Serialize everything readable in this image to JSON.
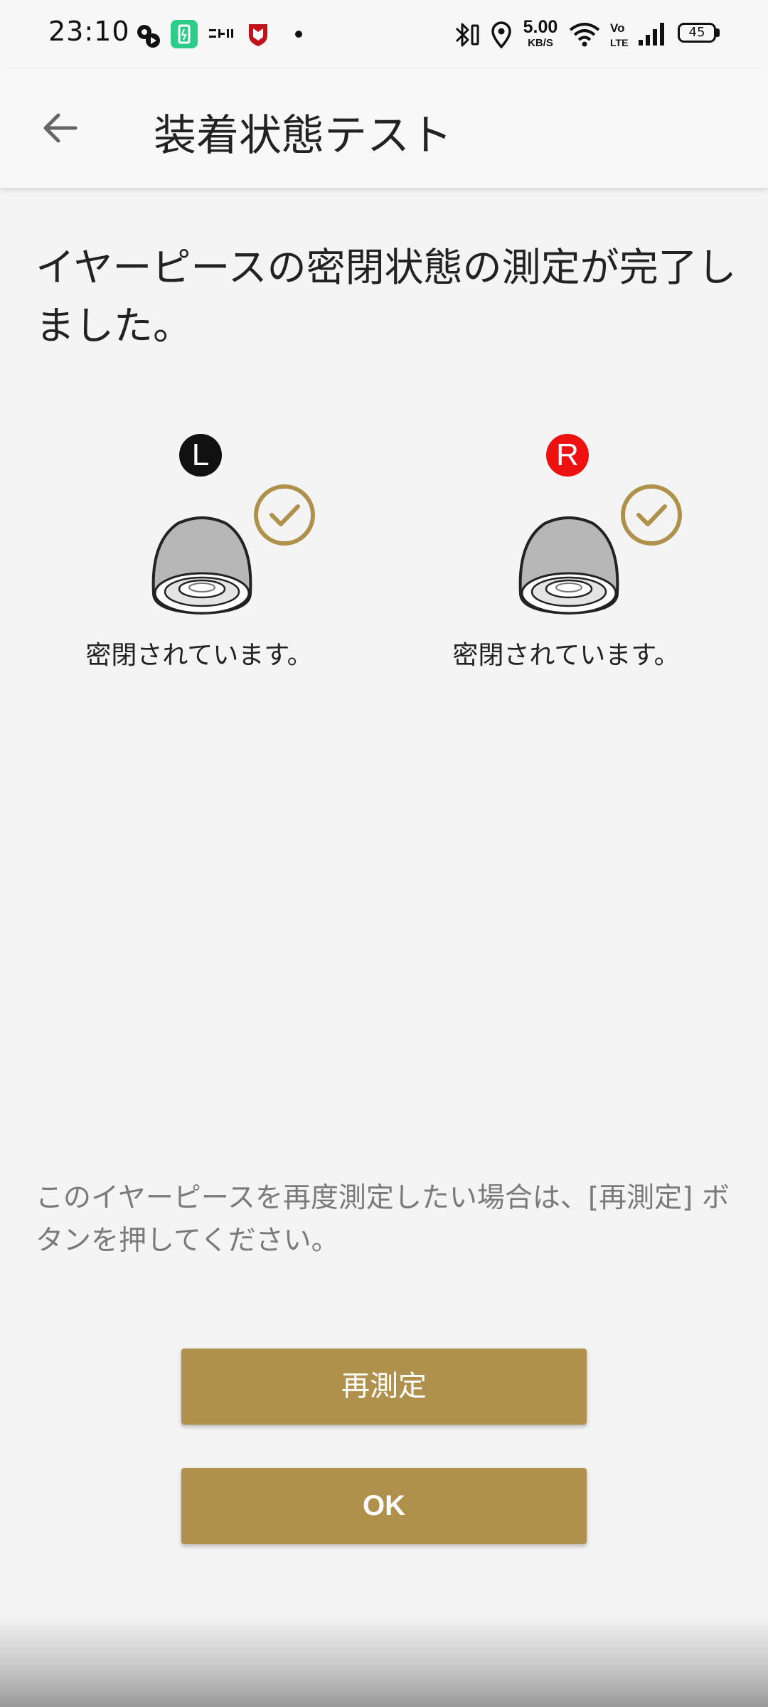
{
  "status_bar": {
    "time": "23:10",
    "speed_value": "5.00",
    "speed_unit": "KB/S",
    "battery": "45",
    "icons": [
      "settings-gear-icon",
      "battery-saver-icon",
      "app-notification-icon",
      "mcafee-shield-icon",
      "dot-icon",
      "bluetooth-icon",
      "location-icon",
      "wifi-icon",
      "volte-icon",
      "signal-icon",
      "battery-icon"
    ]
  },
  "app_bar": {
    "title": "装着状態テスト"
  },
  "headline": "イヤーピースの密閉状態の測定が完了しました。",
  "left_ear": {
    "badge": "L",
    "status": "密閉されています。"
  },
  "right_ear": {
    "badge": "R",
    "status": "密閉されています。"
  },
  "note": "このイヤーピースを再度測定したい場合は、[再測定] ボタンを押してください。",
  "buttons": {
    "remeasure": "再測定",
    "ok": "OK"
  },
  "colors": {
    "accent": "#b0914b",
    "right_badge": "#ee1111",
    "left_badge": "#111111",
    "background": "#f4f4f4"
  }
}
